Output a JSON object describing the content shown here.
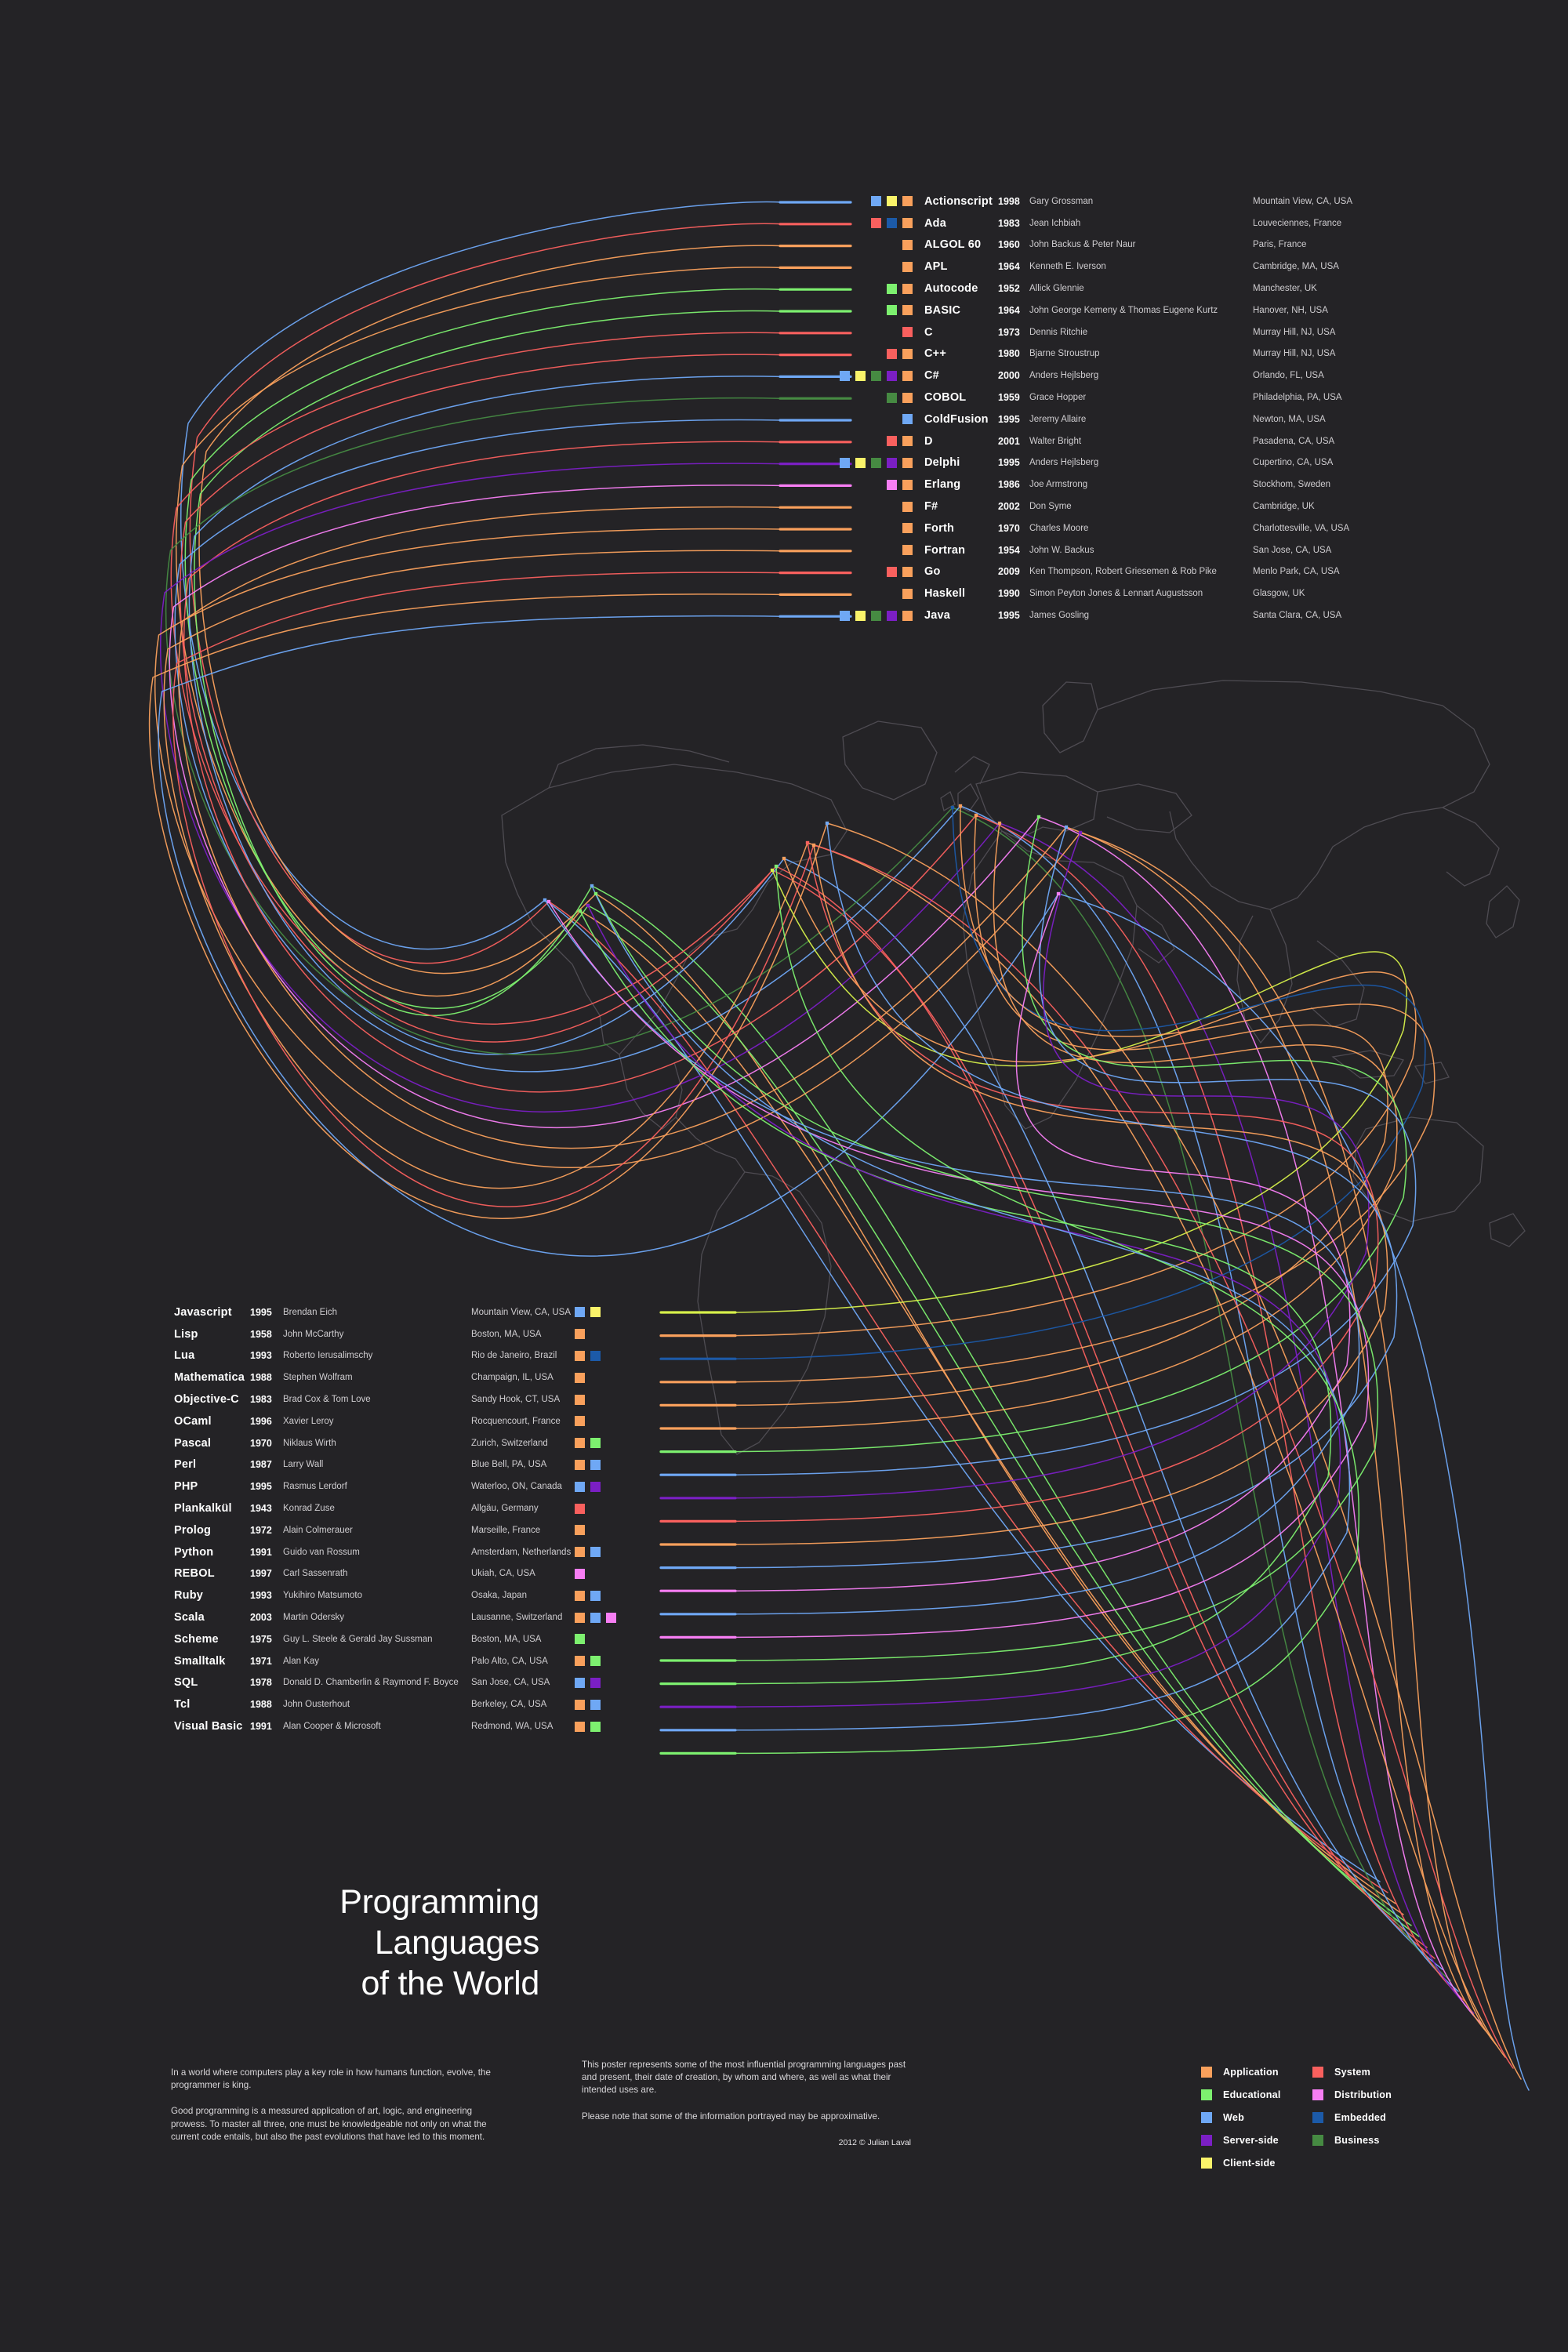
{
  "background": "#242326",
  "title": {
    "line1": "Programming Languages",
    "line2": "of the World"
  },
  "categories": {
    "application": "#F9A05C",
    "educational": "#7DF06F",
    "web": "#6FA8F5",
    "server": "#7B1FC4",
    "client": "#FAF36A",
    "system": "#F9605E",
    "distribution": "#F77EF3",
    "embedded": "#1C5AA8",
    "business": "#468A42"
  },
  "legend": {
    "left": [
      {
        "label": "Application",
        "color": "#F9A05C",
        "key": "application"
      },
      {
        "label": "Educational",
        "color": "#7DF06F",
        "key": "educational"
      },
      {
        "label": "Web",
        "color": "#6FA8F5",
        "key": "web"
      },
      {
        "label": "Server-side",
        "color": "#7B1FC4",
        "key": "server"
      },
      {
        "label": "Client-side",
        "color": "#FAF36A",
        "key": "client"
      }
    ],
    "right": [
      {
        "label": "System",
        "color": "#F9605E",
        "key": "system"
      },
      {
        "label": "Distribution",
        "color": "#F77EF3",
        "key": "distribution"
      },
      {
        "label": "Embedded",
        "color": "#1C5AA8",
        "key": "embedded"
      },
      {
        "label": "Business",
        "color": "#468A42",
        "key": "business"
      }
    ]
  },
  "top_list": [
    {
      "name": "Actionscript",
      "year": "1998",
      "author": "Gary Grossman",
      "city": "Mountain View, CA, USA",
      "colors": [
        "#6FA8F5",
        "#FAF36A",
        "#F9A05C"
      ],
      "arc": "#6FA8F5"
    },
    {
      "name": "Ada",
      "year": "1983",
      "author": "Jean Ichbiah",
      "city": "Louveciennes, France",
      "colors": [
        "#F9605E",
        "#1C5AA8",
        "#F9A05C"
      ],
      "arc": "#F9605E"
    },
    {
      "name": "ALGOL 60",
      "year": "1960",
      "author": "John Backus & Peter Naur",
      "city": "Paris, France",
      "colors": [
        "#F9A05C"
      ],
      "arc": "#F9A05C"
    },
    {
      "name": "APL",
      "year": "1964",
      "author": "Kenneth E. Iverson",
      "city": "Cambridge, MA, USA",
      "colors": [
        "#F9A05C"
      ],
      "arc": "#F9A05C"
    },
    {
      "name": "Autocode",
      "year": "1952",
      "author": "Allick Glennie",
      "city": "Manchester, UK",
      "colors": [
        "#7DF06F",
        "#F9A05C"
      ],
      "arc": "#7DF06F"
    },
    {
      "name": "BASIC",
      "year": "1964",
      "author": "John George Kemeny & Thomas Eugene Kurtz",
      "city": "Hanover, NH, USA",
      "colors": [
        "#7DF06F",
        "#F9A05C"
      ],
      "arc": "#7DF06F"
    },
    {
      "name": "C",
      "year": "1973",
      "author": "Dennis Ritchie",
      "city": "Murray Hill, NJ, USA",
      "colors": [
        "#F9605E"
      ],
      "arc": "#F9605E"
    },
    {
      "name": "C++",
      "year": "1980",
      "author": "Bjarne Stroustrup",
      "city": "Murray Hill, NJ, USA",
      "colors": [
        "#F9605E",
        "#F9A05C"
      ],
      "arc": "#F9605E"
    },
    {
      "name": "C#",
      "year": "2000",
      "author": "Anders Hejlsberg",
      "city": "Orlando, FL, USA",
      "colors": [
        "#6FA8F5",
        "#FAF36A",
        "#468A42",
        "#7B1FC4",
        "#F9A05C"
      ],
      "arc": "#6FA8F5"
    },
    {
      "name": "COBOL",
      "year": "1959",
      "author": "Grace Hopper",
      "city": "Philadelphia, PA, USA",
      "colors": [
        "#468A42",
        "#F9A05C"
      ],
      "arc": "#468A42"
    },
    {
      "name": "ColdFusion",
      "year": "1995",
      "author": "Jeremy Allaire",
      "city": "Newton, MA, USA",
      "colors": [
        "#6FA8F5"
      ],
      "arc": "#6FA8F5"
    },
    {
      "name": "D",
      "year": "2001",
      "author": "Walter Bright",
      "city": "Pasadena, CA, USA",
      "colors": [
        "#F9605E",
        "#F9A05C"
      ],
      "arc": "#F9605E"
    },
    {
      "name": "Delphi",
      "year": "1995",
      "author": "Anders Hejlsberg",
      "city": "Cupertino, CA, USA",
      "colors": [
        "#6FA8F5",
        "#FAF36A",
        "#468A42",
        "#7B1FC4",
        "#F9A05C"
      ],
      "arc": "#7B1FC4"
    },
    {
      "name": "Erlang",
      "year": "1986",
      "author": "Joe Armstrong",
      "city": "Stockhom, Sweden",
      "colors": [
        "#F77EF3",
        "#F9A05C"
      ],
      "arc": "#F77EF3"
    },
    {
      "name": "F#",
      "year": "2002",
      "author": "Don Syme",
      "city": "Cambridge, UK",
      "colors": [
        "#F9A05C"
      ],
      "arc": "#F9A05C"
    },
    {
      "name": "Forth",
      "year": "1970",
      "author": "Charles Moore",
      "city": "Charlottesville, VA, USA",
      "colors": [
        "#F9A05C"
      ],
      "arc": "#F9A05C"
    },
    {
      "name": "Fortran",
      "year": "1954",
      "author": "John W. Backus",
      "city": "San Jose, CA, USA",
      "colors": [
        "#F9A05C"
      ],
      "arc": "#F9A05C"
    },
    {
      "name": "Go",
      "year": "2009",
      "author": "Ken Thompson, Robert Griesemen & Rob Pike",
      "city": "Menlo Park, CA, USA",
      "colors": [
        "#F9605E",
        "#F9A05C"
      ],
      "arc": "#F9605E"
    },
    {
      "name": "Haskell",
      "year": "1990",
      "author": "Simon Peyton Jones & Lennart Augustsson",
      "city": "Glasgow, UK",
      "colors": [
        "#F9A05C"
      ],
      "arc": "#F9A05C"
    },
    {
      "name": "Java",
      "year": "1995",
      "author": "James Gosling",
      "city": "Santa Clara, CA, USA",
      "colors": [
        "#6FA8F5",
        "#FAF36A",
        "#468A42",
        "#7B1FC4",
        "#F9A05C"
      ],
      "arc": "#6FA8F5"
    }
  ],
  "bottom_list": [
    {
      "name": "Javascript",
      "year": "1995",
      "author": "Brendan Eich",
      "city": "Mountain View, CA, USA",
      "colors": [
        "#6FA8F5",
        "#FAF36A"
      ],
      "arc": "#D6F04A"
    },
    {
      "name": "Lisp",
      "year": "1958",
      "author": "John McCarthy",
      "city": "Boston, MA, USA",
      "colors": [
        "#F9A05C"
      ],
      "arc": "#F9A05C"
    },
    {
      "name": "Lua",
      "year": "1993",
      "author": "Roberto Ierusalimschy",
      "city": "Rio de Janeiro, Brazil",
      "colors": [
        "#F9A05C",
        "#1C5AA8"
      ],
      "arc": "#1C5AA8"
    },
    {
      "name": "Mathematica",
      "year": "1988",
      "author": "Stephen Wolfram",
      "city": "Champaign, IL, USA",
      "colors": [
        "#F9A05C"
      ],
      "arc": "#F9A05C"
    },
    {
      "name": "Objective-C",
      "year": "1983",
      "author": "Brad Cox & Tom Love",
      "city": "Sandy Hook, CT, USA",
      "colors": [
        "#F9A05C"
      ],
      "arc": "#F9A05C"
    },
    {
      "name": "OCaml",
      "year": "1996",
      "author": "Xavier Leroy",
      "city": "Rocquencourt, France",
      "colors": [
        "#F9A05C"
      ],
      "arc": "#F9A05C"
    },
    {
      "name": "Pascal",
      "year": "1970",
      "author": "Niklaus Wirth",
      "city": "Zurich, Switzerland",
      "colors": [
        "#F9A05C",
        "#7DF06F"
      ],
      "arc": "#7DF06F"
    },
    {
      "name": "Perl",
      "year": "1987",
      "author": "Larry Wall",
      "city": "Blue Bell, PA, USA",
      "colors": [
        "#F9A05C",
        "#6FA8F5"
      ],
      "arc": "#6FA8F5"
    },
    {
      "name": "PHP",
      "year": "1995",
      "author": "Rasmus Lerdorf",
      "city": "Waterloo, ON, Canada",
      "colors": [
        "#6FA8F5",
        "#7B1FC4"
      ],
      "arc": "#7B1FC4"
    },
    {
      "name": "Plankalkül",
      "year": "1943",
      "author": "Konrad Zuse",
      "city": "Allgäu, Germany",
      "colors": [
        "#F9605E"
      ],
      "arc": "#F9605E"
    },
    {
      "name": "Prolog",
      "year": "1972",
      "author": "Alain Colmerauer",
      "city": "Marseille, France",
      "colors": [
        "#F9A05C"
      ],
      "arc": "#F9A05C"
    },
    {
      "name": "Python",
      "year": "1991",
      "author": "Guido van Rossum",
      "city": "Amsterdam, Netherlands",
      "colors": [
        "#F9A05C",
        "#6FA8F5"
      ],
      "arc": "#6FA8F5"
    },
    {
      "name": "REBOL",
      "year": "1997",
      "author": "Carl Sassenrath",
      "city": "Ukiah, CA, USA",
      "colors": [
        "#F77EF3"
      ],
      "arc": "#F77EF3"
    },
    {
      "name": "Ruby",
      "year": "1993",
      "author": "Yukihiro Matsumoto",
      "city": "Osaka, Japan",
      "colors": [
        "#F9A05C",
        "#6FA8F5"
      ],
      "arc": "#6FA8F5"
    },
    {
      "name": "Scala",
      "year": "2003",
      "author": "Martin Odersky",
      "city": "Lausanne, Switzerland",
      "colors": [
        "#F9A05C",
        "#6FA8F5",
        "#F77EF3"
      ],
      "arc": "#F77EF3"
    },
    {
      "name": "Scheme",
      "year": "1975",
      "author": "Guy L. Steele & Gerald Jay Sussman",
      "city": "Boston, MA, USA",
      "colors": [
        "#7DF06F"
      ],
      "arc": "#7DF06F"
    },
    {
      "name": "Smalltalk",
      "year": "1971",
      "author": "Alan Kay",
      "city": "Palo Alto, CA, USA",
      "colors": [
        "#F9A05C",
        "#7DF06F"
      ],
      "arc": "#7DF06F"
    },
    {
      "name": "SQL",
      "year": "1978",
      "author": "Donald D. Chamberlin & Raymond F. Boyce",
      "city": "San Jose, CA, USA",
      "colors": [
        "#6FA8F5",
        "#7B1FC4"
      ],
      "arc": "#7B1FC4"
    },
    {
      "name": "Tcl",
      "year": "1988",
      "author": "John Ousterhout",
      "city": "Berkeley, CA, USA",
      "colors": [
        "#F9A05C",
        "#6FA8F5"
      ],
      "arc": "#6FA8F5"
    },
    {
      "name": "Visual Basic",
      "year": "1991",
      "author": "Alan Cooper & Microsoft",
      "city": "Redmond, WA, USA",
      "colors": [
        "#F9A05C",
        "#7DF06F"
      ],
      "arc": "#7DF06F"
    }
  ],
  "footer": {
    "left_p1": "In a world where computers play a key role in how humans function, evolve, the programmer is king.",
    "left_p2": "Good programming is a measured application of art, logic, and engineering prowess. To master all three, one must be knowledgeable not only on what the current code entails, but also the past evolutions that have led to this moment.",
    "right_p1": "This poster represents some of the most influential programming languages past and present, their date of creation, by whom and where, as well as what their intended uses are.",
    "right_p2": "Please note that some of the information portrayed may be approximative.",
    "copyright": "2012 © Julian Laval"
  }
}
